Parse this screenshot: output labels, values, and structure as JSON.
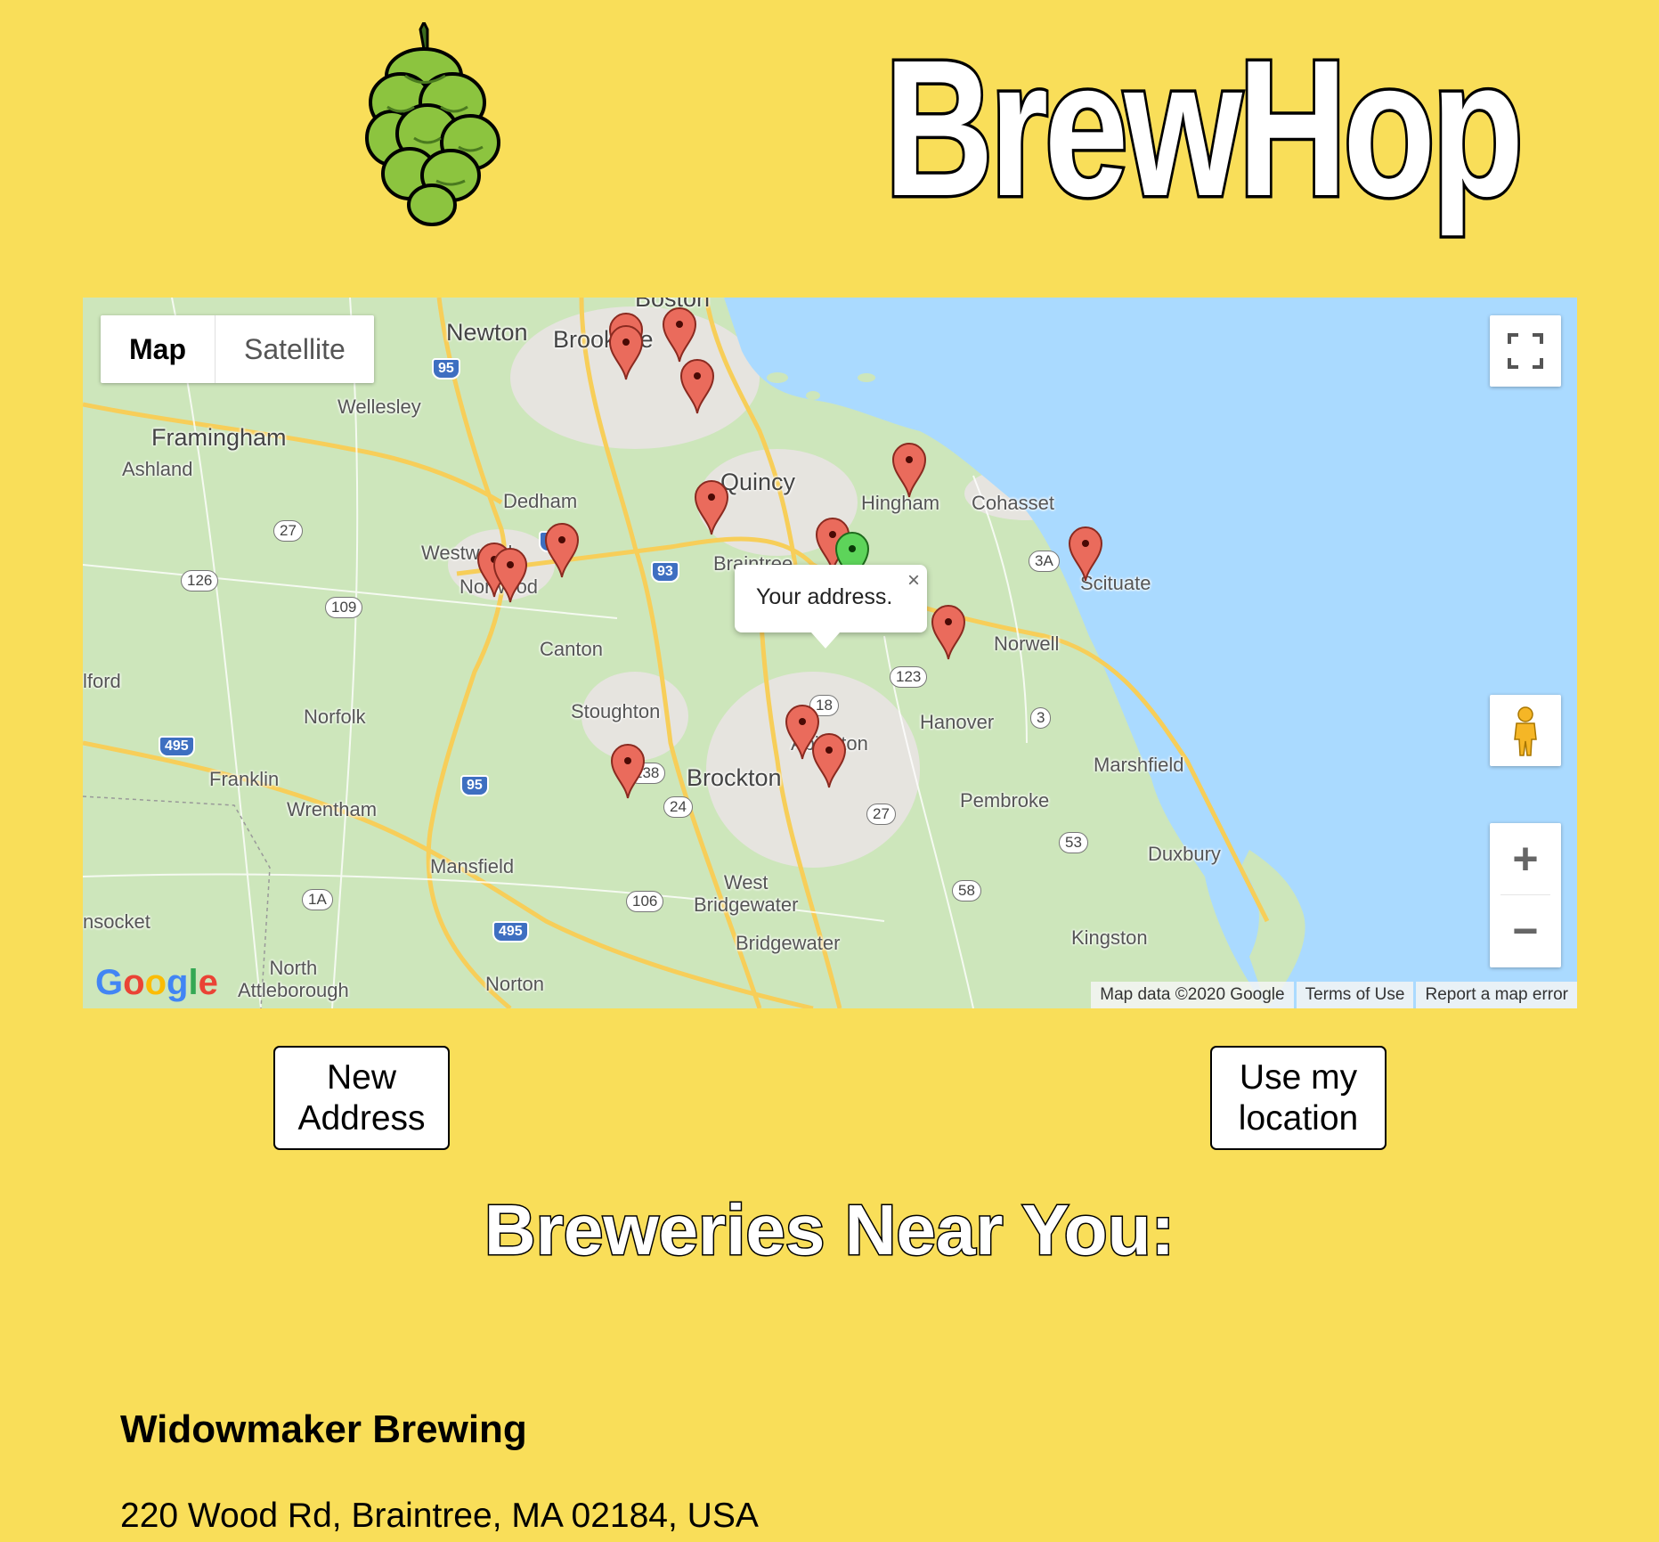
{
  "header": {
    "app_name": "BrewHop",
    "logo_icon": "hop-cone-icon"
  },
  "map": {
    "type_controls": {
      "map_label": "Map",
      "satellite_label": "Satellite",
      "selected": "Map"
    },
    "infowindow": {
      "text": "Your address.",
      "close_label": "×"
    },
    "zoom_in_label": "+",
    "zoom_out_label": "−",
    "attribution": {
      "map_data": "Map data ©2020 Google",
      "terms": "Terms of Use",
      "report": "Report a map error"
    },
    "google_logo": "Google",
    "place_labels": {
      "boston": "Boston",
      "newton": "Newton",
      "brookline": "Brookline",
      "wellesley": "Wellesley",
      "framingham": "Framingham",
      "ashland": "Ashland",
      "quincy": "Quincy",
      "hingham": "Hingham",
      "cohasset": "Cohasset",
      "dedham": "Dedham",
      "westwood": "Westwood",
      "norwood": "Norwood",
      "braintree": "Braintree",
      "scituate": "Scituate",
      "norwell": "Norwell",
      "canton": "Canton",
      "milford": "lford",
      "stoughton": "Stoughton",
      "hanover": "Hanover",
      "norfolk": "Norfolk",
      "abington": "Abington",
      "marshfield": "Marshfield",
      "franklin": "Franklin",
      "brockton": "Brockton",
      "wrentham": "Wrentham",
      "pembroke": "Pembroke",
      "duxbury": "Duxbury",
      "mansfield": "Mansfield",
      "west_bridgewater": "West\nBridgewater",
      "woonsocket": "nsocket",
      "bridgewater": "Bridgewater",
      "kingston": "Kingston",
      "north_attleborough": "North\nAttleborough",
      "norton": "Norton"
    },
    "routes": {
      "i95a": "95",
      "i95b": "95",
      "i95c": "95",
      "i93": "93",
      "i495a": "495",
      "i495b": "495",
      "r27a": "27",
      "r126": "126",
      "r109": "109",
      "r3a": "3A",
      "r123": "123",
      "r18": "18",
      "r3": "3",
      "r138": "138",
      "r24": "24",
      "r27b": "27",
      "r53": "53",
      "r1a": "1A",
      "r106": "106",
      "r58": "58"
    },
    "colors": {
      "water": "#AADAFF",
      "land": "#CDE6BB",
      "pin_brewery": "#EA6B5C",
      "pin_user": "#5DD45A",
      "background": "#F9DE59"
    }
  },
  "buttons": {
    "new_address": "New\nAddress",
    "use_location": "Use my\nlocation"
  },
  "heading": "Breweries Near You:",
  "breweries": [
    {
      "name": "Widowmaker Brewing",
      "address": "220 Wood Rd, Braintree, MA 02184, USA"
    }
  ]
}
